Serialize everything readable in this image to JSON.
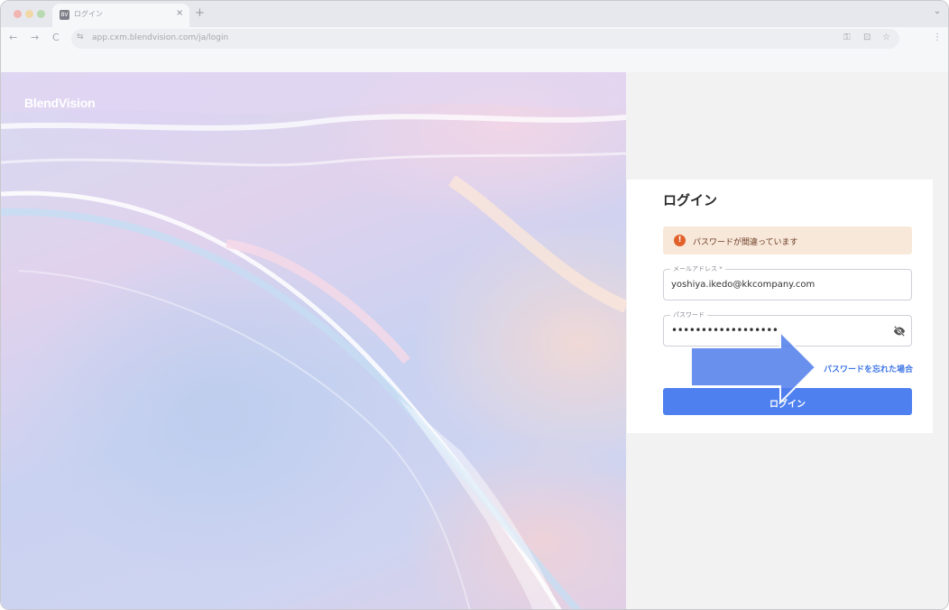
{
  "browser": {
    "tab": {
      "title": "ログイン",
      "favicon_text": "BV",
      "close_label": "×"
    },
    "new_tab_label": "+",
    "tab_menu_label": "⌄",
    "nav": {
      "back": "←",
      "forward": "→",
      "reload": "C"
    },
    "address_bar": {
      "url": "app.cxm.blendvision.com/ja/login",
      "site_info_icon": "⇆"
    },
    "toolbar_icons": {
      "key": "⚿",
      "install": "⊡",
      "bookmark": "☆"
    },
    "menu_label": "⋮"
  },
  "hero": {
    "logo_text": "BlendVision"
  },
  "login": {
    "title": "ログイン",
    "alert": {
      "icon": "!",
      "message": "パスワードが間違っています",
      "color": "#e1612a"
    },
    "email": {
      "label": "メールアドレス *",
      "value": "yoshiya.ikedo@kkcompany.com"
    },
    "password": {
      "label": "パスワード",
      "value": "••••••••••••••••••"
    },
    "forgot_link": "パスワードを忘れた場合",
    "submit_label": "ログイン",
    "accent_color": "#4f80f0"
  }
}
